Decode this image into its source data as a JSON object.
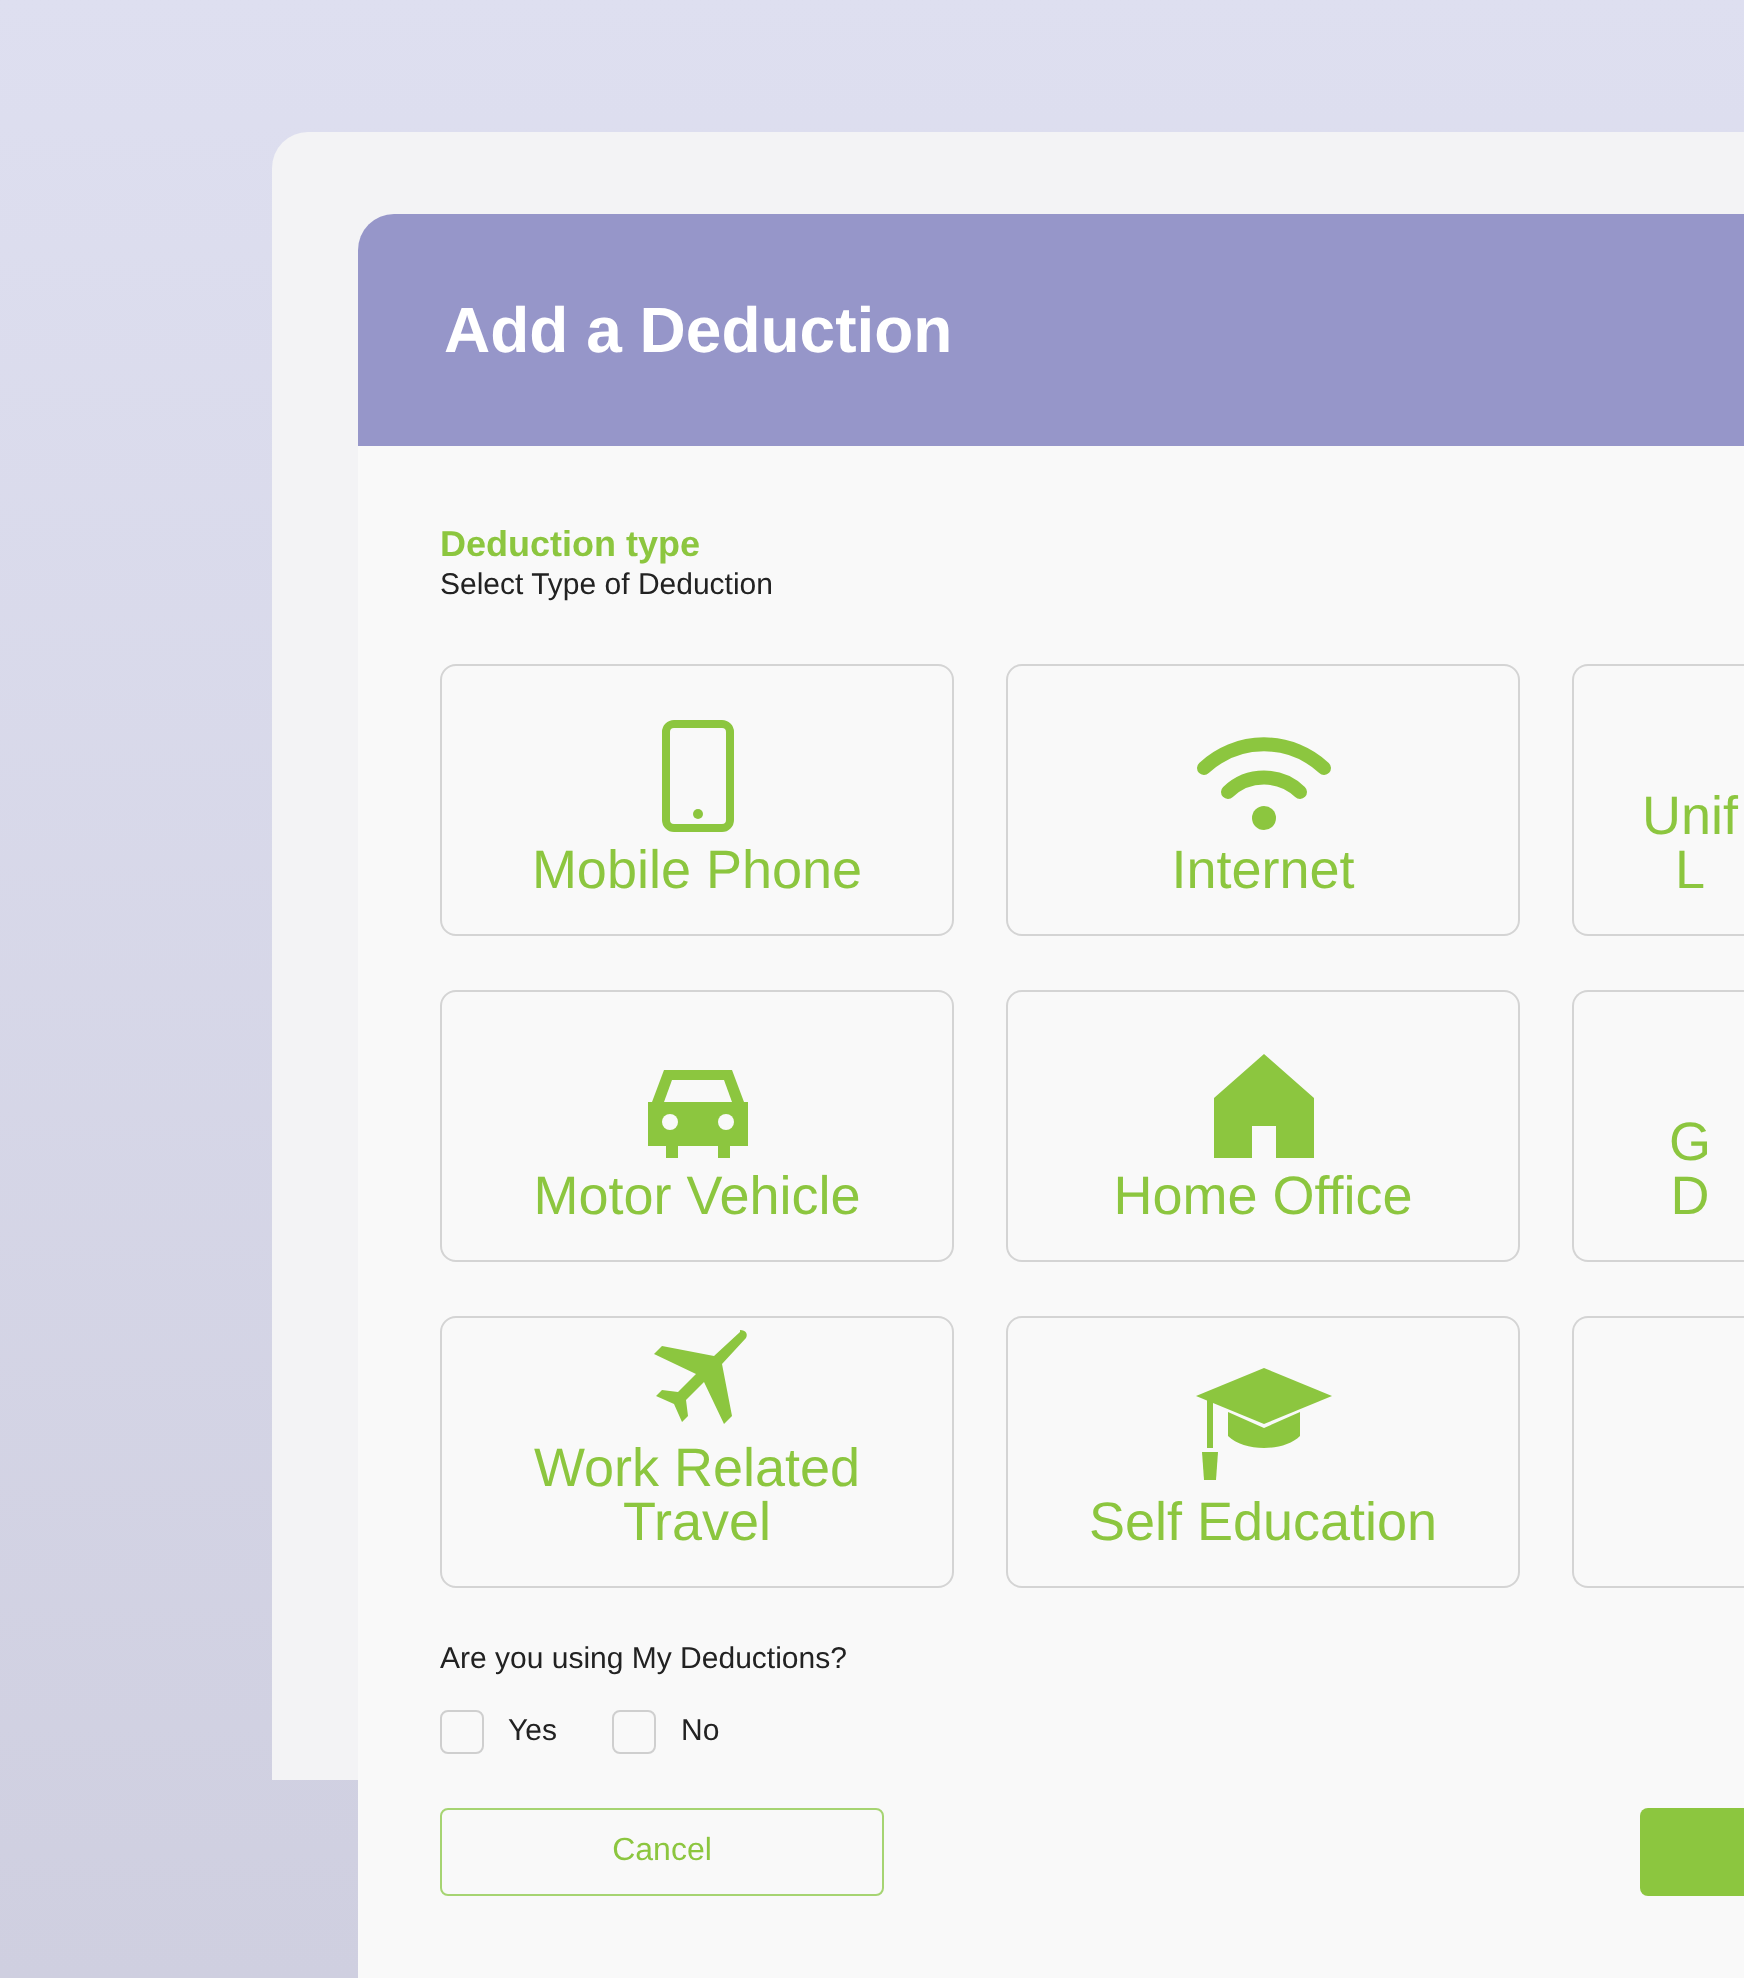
{
  "dialog": {
    "title": "Add a Deduction"
  },
  "section": {
    "heading": "Deduction type",
    "subheading": "Select Type of Deduction"
  },
  "tiles": [
    {
      "lines": [
        "Mobile Phone"
      ],
      "selected": false
    },
    {
      "lines": [
        "Internet"
      ],
      "selected": false
    },
    {
      "lines": [
        "Unif",
        "L"
      ],
      "selected": false
    },
    {
      "lines": [
        "Motor Vehicle"
      ],
      "selected": false
    },
    {
      "lines": [
        "Home Office"
      ],
      "selected": false
    },
    {
      "lines": [
        "G",
        "D"
      ],
      "selected": false
    },
    {
      "lines": [
        "Work Related",
        "Travel"
      ],
      "selected": false
    },
    {
      "lines": [
        "Self Education"
      ],
      "selected": false
    },
    {
      "selected": false
    }
  ],
  "question": {
    "text": "Are you using My Deductions?",
    "options": [
      {
        "label": "Yes",
        "checked": false
      },
      {
        "label": "No",
        "checked": false
      }
    ]
  },
  "buttons": {
    "cancel": "Cancel"
  }
}
